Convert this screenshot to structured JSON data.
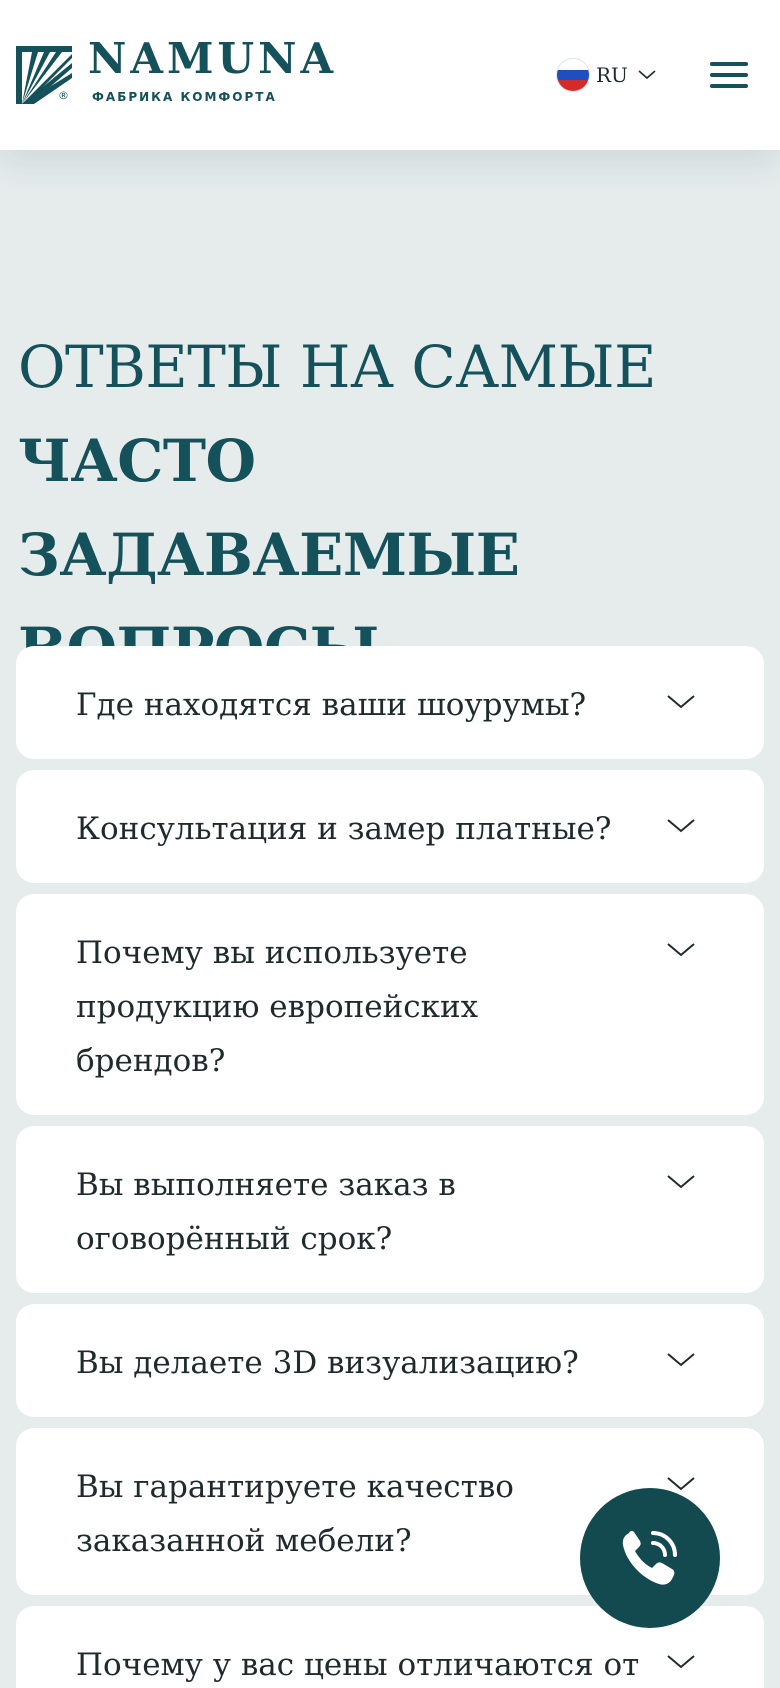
{
  "header": {
    "logo_text": "NAMUNA",
    "logo_subtitle": "ФАБРИКА КОМФОРТА",
    "logo_registered": "®",
    "language": {
      "code": "RU",
      "flag_colors": [
        "#ffffff",
        "#1f4fbf",
        "#d42a2a"
      ]
    },
    "menu_icon": "hamburger-icon"
  },
  "faq": {
    "title_line1": "ОТВЕТЫ НА САМЫЕ",
    "title_line2": "ЧАСТО ЗАДАВАЕМЫЕ",
    "title_line3": "ВОПРОСЫ",
    "items": [
      {
        "question": "Где находятся ваши шоурумы?"
      },
      {
        "question": "Консультация и замер платные?"
      },
      {
        "question": "Почему вы используете продукцию европейских брендов?"
      },
      {
        "question": "Вы выполняете заказ в оговорённый срок?"
      },
      {
        "question": "Вы делаете 3D визуализацию?"
      },
      {
        "question": "Вы гарантируете качество заказанной мебели?"
      },
      {
        "question": "Почему у вас цены отличаются от"
      }
    ]
  },
  "call_button": {
    "icon": "phone-call-icon"
  },
  "colors": {
    "brand": "#14515a",
    "background": "#e6ecec",
    "card": "#ffffff",
    "text": "#1e2a2c",
    "call_button": "#124a50"
  }
}
